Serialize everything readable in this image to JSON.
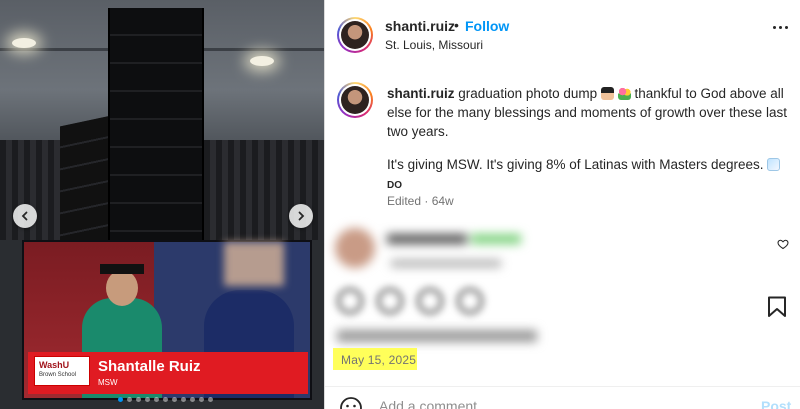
{
  "post": {
    "username": "shanti.ruiz",
    "separator": "•",
    "follow_label": "Follow",
    "location": "St. Louis, Missouri",
    "caption": {
      "username": "shanti.ruiz",
      "line1": "graduation photo dump",
      "line1b": "thankful to God above all else for the many blessings and moments of growth over these last two years.",
      "line2": "It's giving MSW. It's giving 8% of Latinas with Masters degrees.",
      "line2b": "DO"
    },
    "edited": "Edited · 64w",
    "date": "May 15, 2025",
    "add_comment_placeholder": "Add a comment...",
    "post_label": "Post"
  },
  "photo": {
    "logo_line1": "WashU",
    "logo_line2": "Brown School",
    "name": "Shantalle Ruiz",
    "degree": "MSW",
    "carousel_total": 11,
    "carousel_active": 0
  },
  "icons": {
    "prev": "chevron-left-icon",
    "next": "chevron-right-icon",
    "more": "more-options-icon",
    "heart": "heart-icon",
    "bookmark": "bookmark-icon",
    "emoji": "smiley-icon"
  },
  "colors": {
    "accent": "#0095f6",
    "highlight": "#ffff5a",
    "muted": "#737373"
  }
}
